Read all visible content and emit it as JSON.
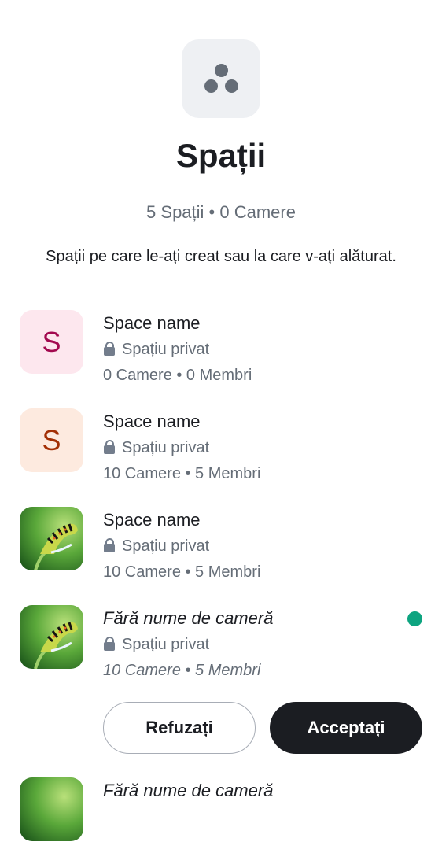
{
  "header": {
    "icon": "spaces-icon",
    "title": "Spații",
    "subtitle": "5 Spații • 0 Camere",
    "description": "Spații pe care le-ați creat sau la care v-ați alăturat."
  },
  "spaces": [
    {
      "avatar_letter": "S",
      "avatar_color": "#a3094f",
      "name": "Space name",
      "privacy": "Spațiu privat",
      "counts": "0 Camere • 0 Membri"
    },
    {
      "avatar_letter": "S",
      "avatar_color": "#a32f04",
      "name": "Space name",
      "privacy": "Spațiu privat",
      "counts": "10 Camere • 5 Membri"
    },
    {
      "avatar_image": "caterpillar-photo",
      "name": "Space name",
      "privacy": "Spațiu privat",
      "counts": "10 Camere • 5 Membri"
    },
    {
      "avatar_image": "caterpillar-photo",
      "name": "Fără nume de cameră",
      "privacy": "Spațiu privat",
      "counts": "10 Camere • 5 Membri",
      "unread_indicator_color": "#0da480",
      "actions": {
        "decline_label": "Refuzați",
        "accept_label": "Acceptați"
      }
    },
    {
      "avatar_image": "caterpillar-photo",
      "name": "Fără nume de cameră"
    }
  ],
  "lock_icon": "lock-icon"
}
